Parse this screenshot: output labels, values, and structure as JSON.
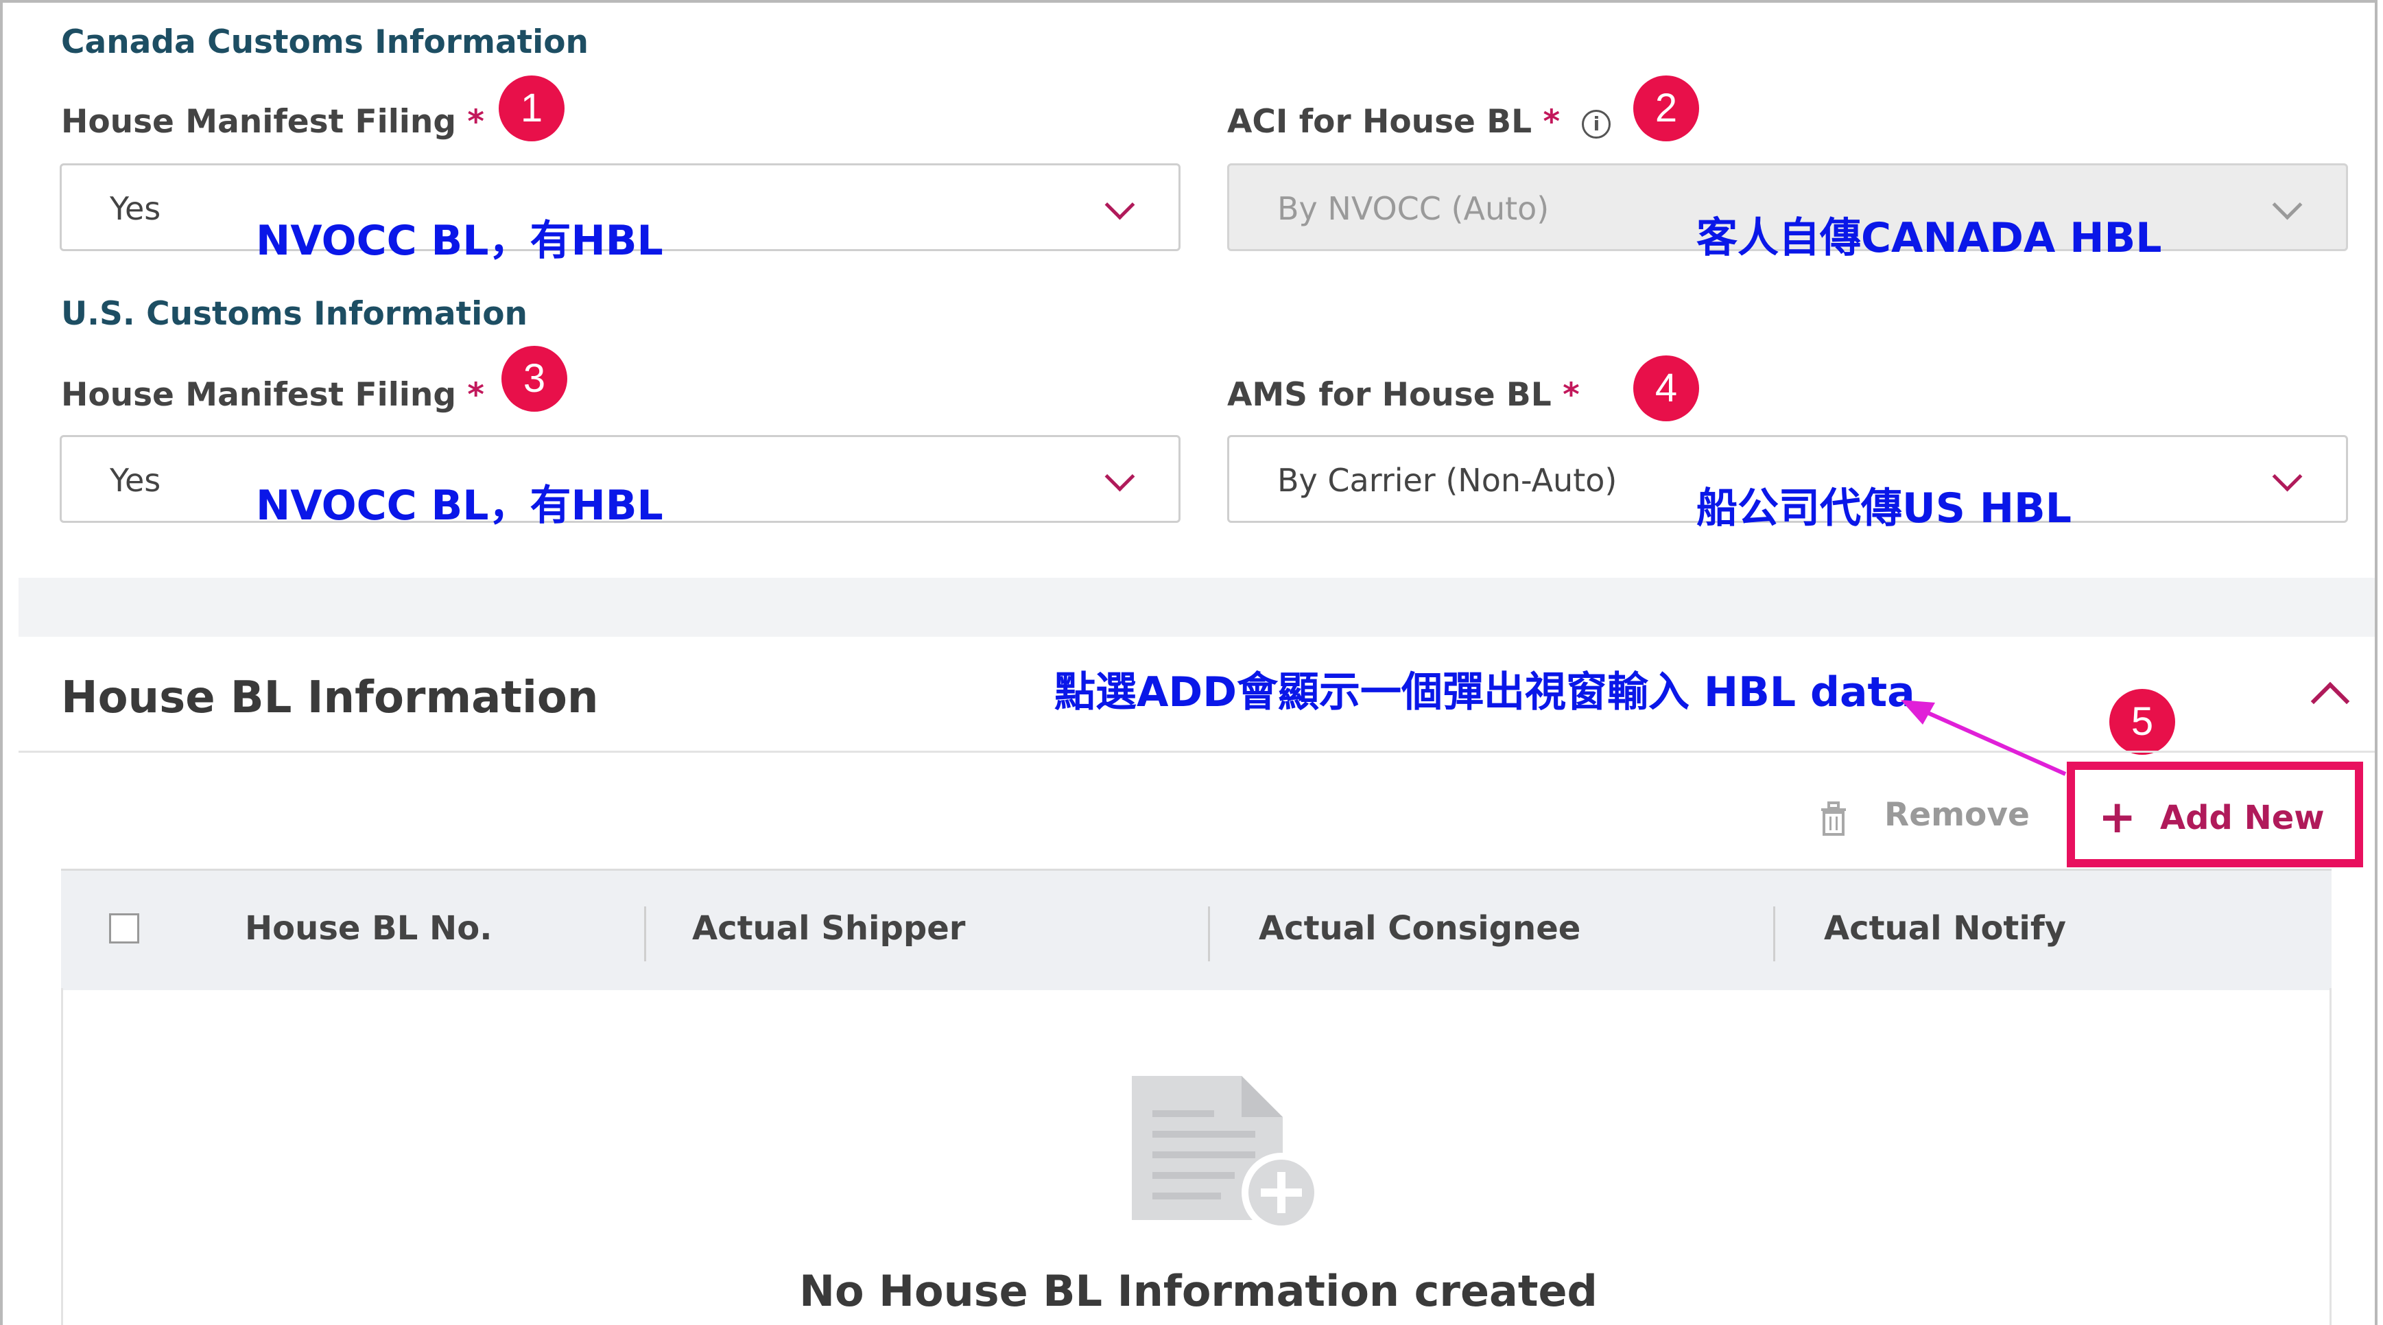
{
  "canada": {
    "title": "Canada Customs Information",
    "house_manifest_label": "House Manifest Filing",
    "house_manifest_value": "Yes",
    "aci_label": "ACI for House BL",
    "aci_value": "By NVOCC (Auto)"
  },
  "us": {
    "title": "U.S. Customs Information",
    "house_manifest_label": "House Manifest Filing",
    "house_manifest_value": "Yes",
    "ams_label": "AMS for House BL",
    "ams_value": "By Carrier (Non-Auto)"
  },
  "required_mark": "*",
  "annotations": {
    "a1": "NVOCC BL，有HBL",
    "a2": "客人自傳CANADA HBL",
    "a3": "NVOCC BL，有HBL",
    "a4": "船公司代傳US HBL",
    "a5": "點選ADD會顯示一個彈出視窗輸入 HBL data"
  },
  "badges": [
    "1",
    "2",
    "3",
    "4",
    "5"
  ],
  "house_bl": {
    "title": "House BL Information",
    "remove_label": "Remove",
    "add_new_plus": "+",
    "add_new_label": "Add New",
    "columns": [
      "House BL No.",
      "Actual Shipper",
      "Actual Consignee",
      "Actual Notify"
    ],
    "empty_message": "No House BL Information created"
  },
  "colors": {
    "accent": "#b01a5a",
    "badge": "#e8104a",
    "annotation": "#0a17e8",
    "highlight": "#e8105e",
    "arrow": "#e020d8"
  },
  "icons": [
    "info-icon",
    "chevron-down-icon",
    "chevron-up-icon",
    "trash-icon",
    "plus-icon",
    "document-add-icon"
  ]
}
